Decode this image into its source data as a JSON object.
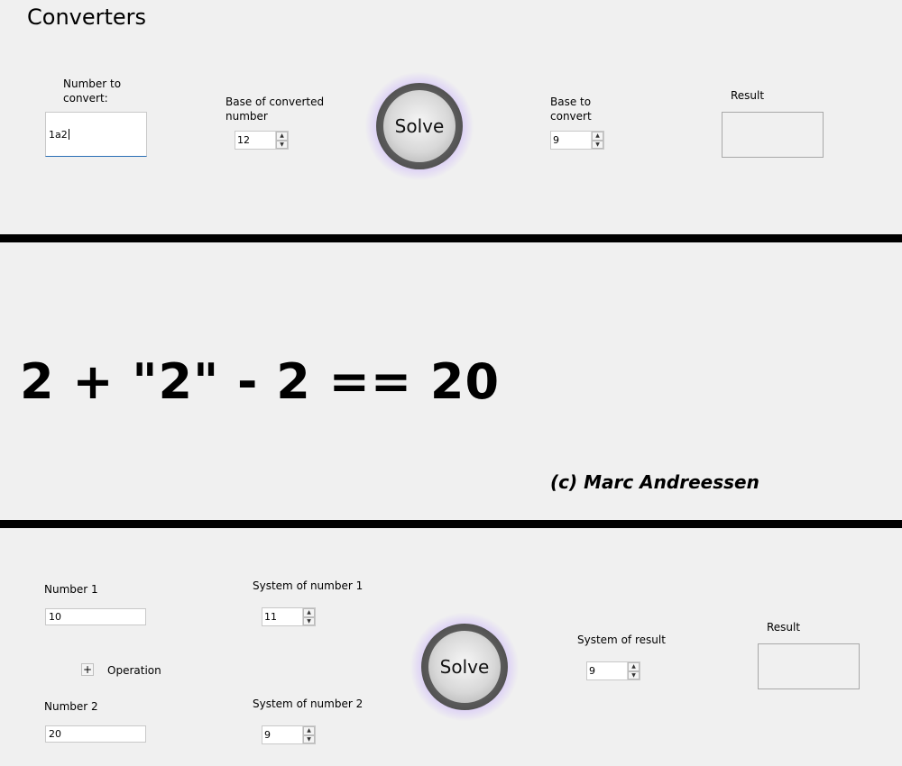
{
  "app": {
    "title": "Converters"
  },
  "converter": {
    "number_label": "Number to convert:",
    "number_value": "1a2",
    "base_from_label": "Base of converted number",
    "base_from_value": "12",
    "solve_label": "Solve",
    "base_to_label": "Base to convert",
    "base_to_value": "9",
    "result_label": "Result",
    "result_value": ""
  },
  "banner": {
    "equation": "2 + \"2\" - 2 == 20",
    "credit": "(c) Marc Andreessen"
  },
  "calculator": {
    "number1_label": "Number 1",
    "number1_value": "10",
    "system1_label": "System of number 1",
    "system1_value": "11",
    "operation_symbol": "+",
    "operation_label": "Operation",
    "number2_label": "Number 2",
    "number2_value": "20",
    "system2_label": "System of number 2",
    "system2_value": "9",
    "solve_label": "Solve",
    "system_result_label": "System of result",
    "system_result_value": "9",
    "result_label": "Result",
    "result_value": ""
  },
  "icons": {
    "spin_up": "▲",
    "spin_down": "▼"
  },
  "colors": {
    "background": "#f0f0f0",
    "separator": "#000000",
    "focus_underline": "#2a6fb6",
    "solve_glow": "#ff7878"
  }
}
